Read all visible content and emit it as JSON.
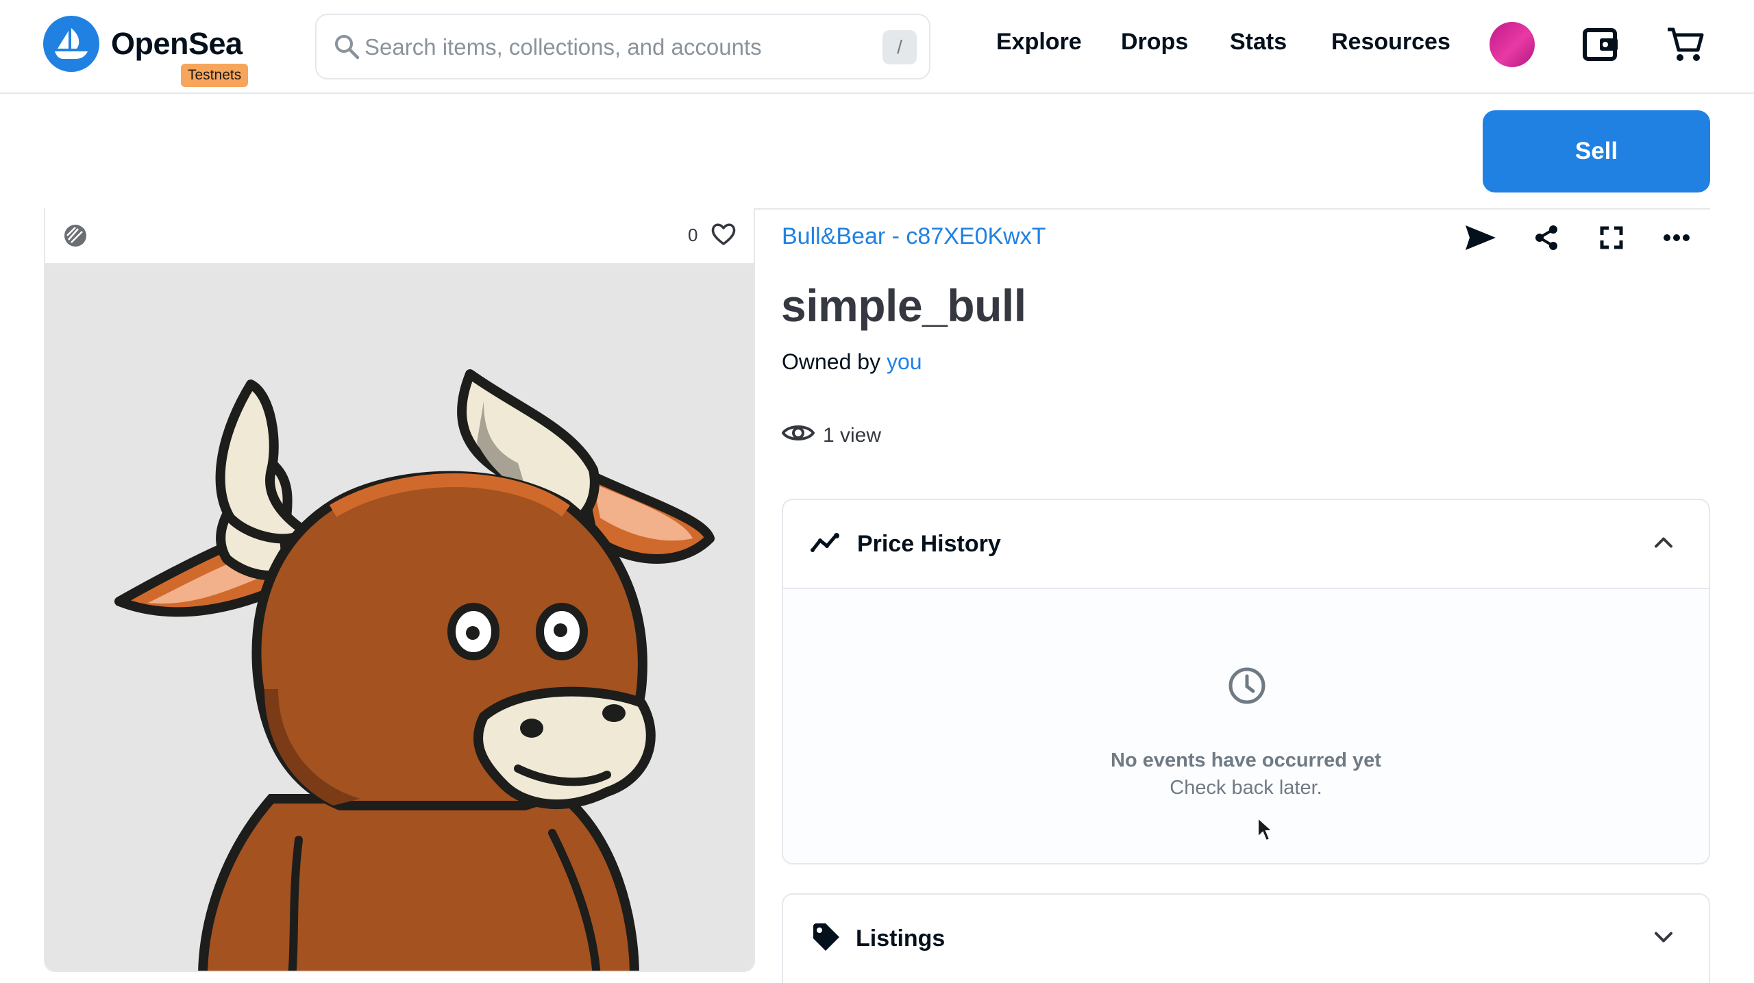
{
  "header": {
    "brand": "OpenSea",
    "badge": "Testnets",
    "search_placeholder": "Search items, collections, and accounts",
    "search_shortcut": "/",
    "nav": [
      "Explore",
      "Drops",
      "Stats",
      "Resources"
    ],
    "icons": [
      "search-icon",
      "profile-avatar",
      "wallet-icon",
      "cart-icon"
    ]
  },
  "actions": {
    "sell_label": "Sell"
  },
  "media": {
    "favorites": "0",
    "icons": [
      "chain-icon",
      "heart-icon"
    ]
  },
  "item": {
    "collection": "Bull&Bear - c87XE0KwxT",
    "name": "simple_bull",
    "owned_prefix": "Owned by",
    "owner": "you",
    "views": "1 view",
    "action_icons": [
      "transfer-icon",
      "share-icon",
      "fullscreen-icon",
      "more-icon"
    ]
  },
  "price_history": {
    "title": "Price History",
    "empty_title": "No events have occurred yet",
    "empty_subtitle": "Check back later."
  },
  "listings": {
    "title": "Listings"
  },
  "colors": {
    "accent": "#2081e2",
    "badge": "#f6a55a",
    "text": "#04111d",
    "muted": "#707a83",
    "bull": "#a4521f"
  }
}
